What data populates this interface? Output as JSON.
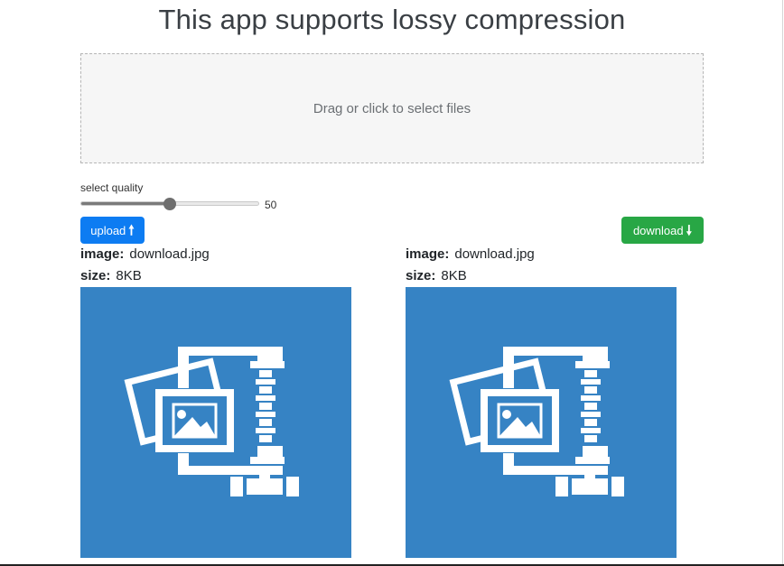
{
  "header": {
    "title": "This app supports lossy compression"
  },
  "dropzone": {
    "text": "Drag or click to select files"
  },
  "quality": {
    "label": "select quality",
    "value": "50",
    "fraction": 0.5
  },
  "buttons": {
    "upload_label": "upload",
    "upload_icon": "arrow-up-icon",
    "download_label": "download",
    "download_icon": "arrow-down-icon"
  },
  "colors": {
    "upload_button": "#0d7cf2",
    "download_button": "#28a745",
    "preview_background": "#3683c4"
  },
  "original": {
    "image_label": "image:",
    "image_name": "download.jpg",
    "size_label": "size:",
    "size_value": "8KB",
    "preview_icon": "image-compress-icon"
  },
  "compressed": {
    "image_label": "image:",
    "image_name": "download.jpg",
    "size_label": "size:",
    "size_value": "8KB",
    "preview_icon": "image-compress-icon"
  }
}
